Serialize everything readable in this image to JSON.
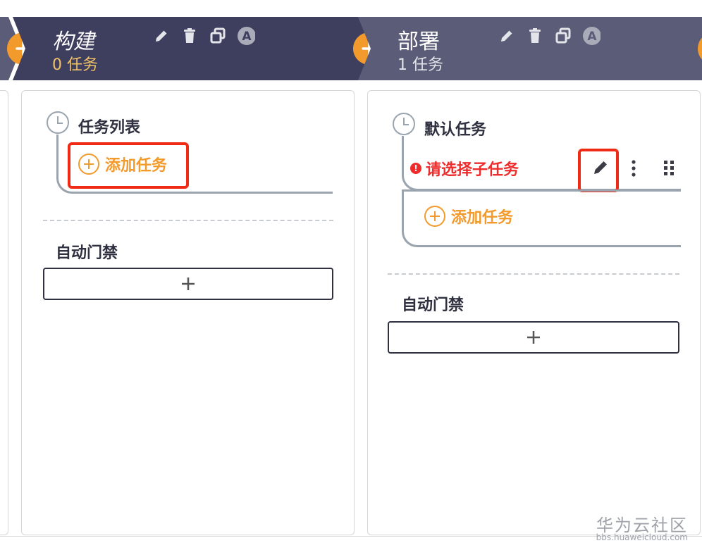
{
  "stages": [
    {
      "name": "构建",
      "task_count": "0 任务",
      "count_color": "#f2c266",
      "header_color": "#3e3f5e",
      "tools": [
        "pencil-icon",
        "trash-icon",
        "copy-icon",
        "a-badge-icon"
      ],
      "badge_letter": "A"
    },
    {
      "name": "部署",
      "task_count": "1 任务",
      "count_color": "#e3e4ea",
      "header_color": "#5b5c78",
      "tools": [
        "pencil-icon",
        "trash-icon",
        "copy-icon",
        "a-badge-icon"
      ],
      "badge_letter": "A"
    }
  ],
  "build_panel": {
    "group_title": "任务列表",
    "add_task_label": "添加任务",
    "gate_label": "自动门禁",
    "gate_button": "+"
  },
  "deploy_panel": {
    "group_title": "默认任务",
    "error_icon": "!",
    "error_text": "请选择子任务",
    "add_task_label": "添加任务",
    "gate_label": "自动门禁",
    "gate_button": "+"
  },
  "watermark": {
    "title": "华为云社区",
    "url": "bbs.huaweicloud.com"
  },
  "colors": {
    "accent_orange": "#f39a2c",
    "error_red": "#ef2b2b",
    "highlight_red": "#ef2b16"
  }
}
